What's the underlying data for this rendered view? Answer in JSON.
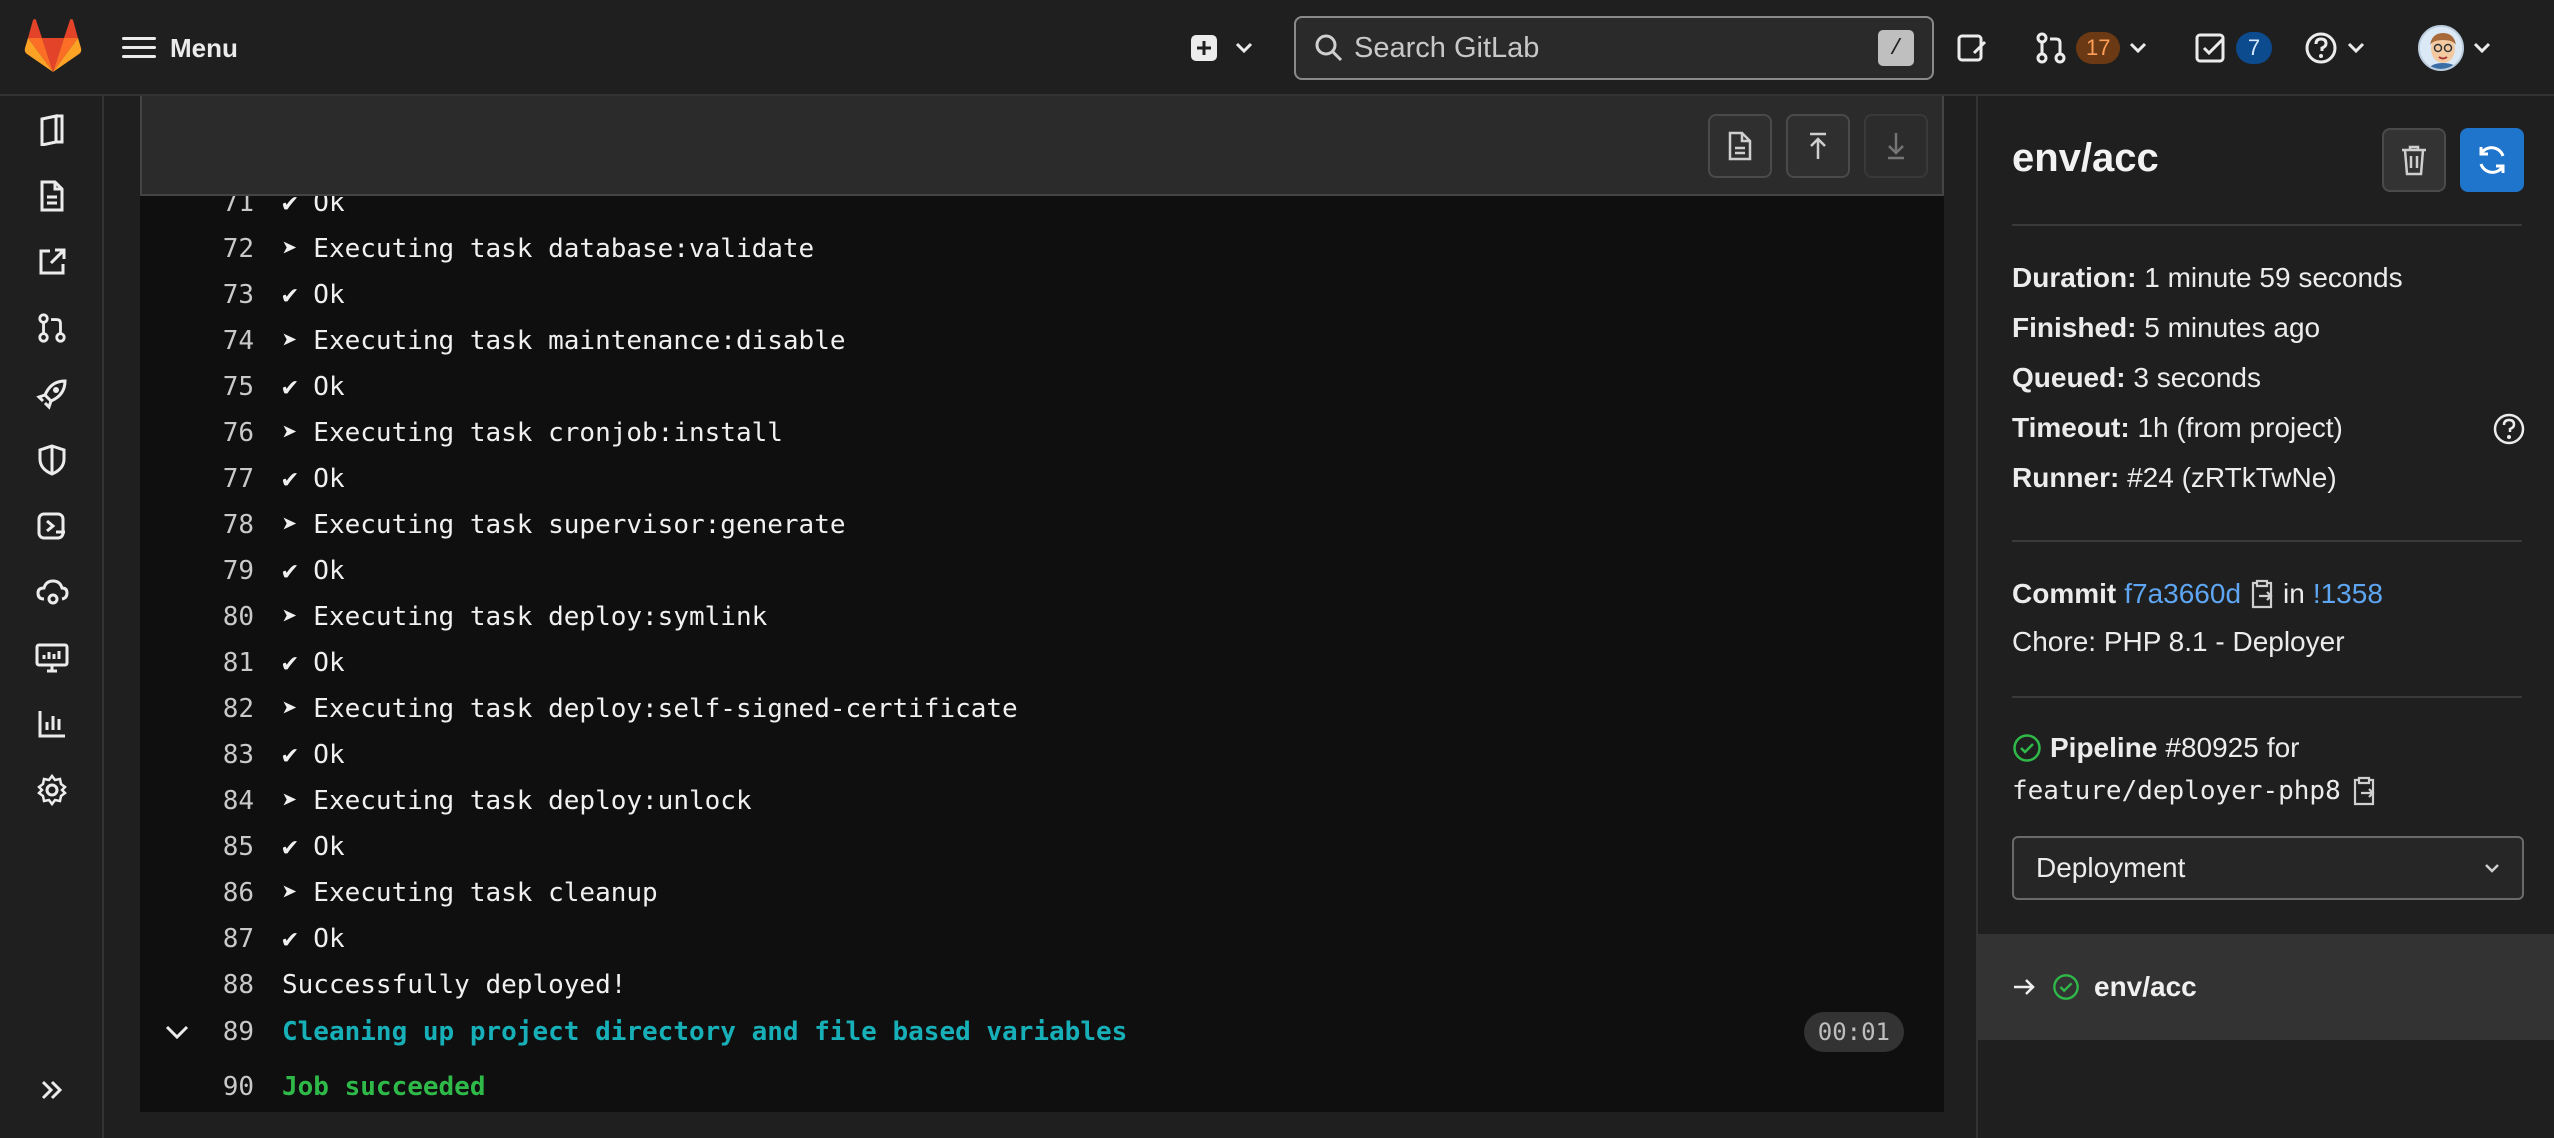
{
  "topbar": {
    "menu_label": "Menu",
    "search_placeholder": "Search GitLab",
    "search_shortcut": "/",
    "merge_requests_count": "17",
    "todos_count": "7"
  },
  "log_lines": [
    {
      "n": "71",
      "text": "✔ Ok"
    },
    {
      "n": "72",
      "text": "➤ Executing task database:validate"
    },
    {
      "n": "73",
      "text": "✔ Ok"
    },
    {
      "n": "74",
      "text": "➤ Executing task maintenance:disable"
    },
    {
      "n": "75",
      "text": "✔ Ok"
    },
    {
      "n": "76",
      "text": "➤ Executing task cronjob:install"
    },
    {
      "n": "77",
      "text": "✔ Ok"
    },
    {
      "n": "78",
      "text": "➤ Executing task supervisor:generate"
    },
    {
      "n": "79",
      "text": "✔ Ok"
    },
    {
      "n": "80",
      "text": "➤ Executing task deploy:symlink"
    },
    {
      "n": "81",
      "text": "✔ Ok"
    },
    {
      "n": "82",
      "text": "➤ Executing task deploy:self-signed-certificate"
    },
    {
      "n": "83",
      "text": "✔ Ok"
    },
    {
      "n": "84",
      "text": "➤ Executing task deploy:unlock"
    },
    {
      "n": "85",
      "text": "✔ Ok"
    },
    {
      "n": "86",
      "text": "➤ Executing task cleanup"
    },
    {
      "n": "87",
      "text": "✔ Ok"
    },
    {
      "n": "88",
      "text": "Successfully deployed!"
    }
  ],
  "section_line": {
    "n": "89",
    "text": "Cleaning up project directory and file based variables",
    "duration": "00:01"
  },
  "final_line": {
    "n": "90",
    "text": "Job succeeded"
  },
  "job": {
    "title": "env/acc",
    "duration_label": "Duration:",
    "duration": "1 minute 59 seconds",
    "finished_label": "Finished:",
    "finished": "5 minutes ago",
    "queued_label": "Queued:",
    "queued": "3 seconds",
    "timeout_label": "Timeout:",
    "timeout": "1h (from project)",
    "runner_label": "Runner:",
    "runner": "#24 (zRTkTwNe)",
    "commit_label": "Commit",
    "commit_sha": "f7a3660d",
    "commit_in": "in",
    "commit_mr": "!1358",
    "commit_message": "Chore: PHP 8.1 - Deployer",
    "pipeline_label": "Pipeline",
    "pipeline_id": "#80925",
    "pipeline_for": "for",
    "branch": "feature/deployer-php8",
    "stage": "Deployment",
    "current_job": "env/acc"
  },
  "colors": {
    "accent": "#1f75cb",
    "success": "#2fb949",
    "link": "#5ea6f2"
  }
}
